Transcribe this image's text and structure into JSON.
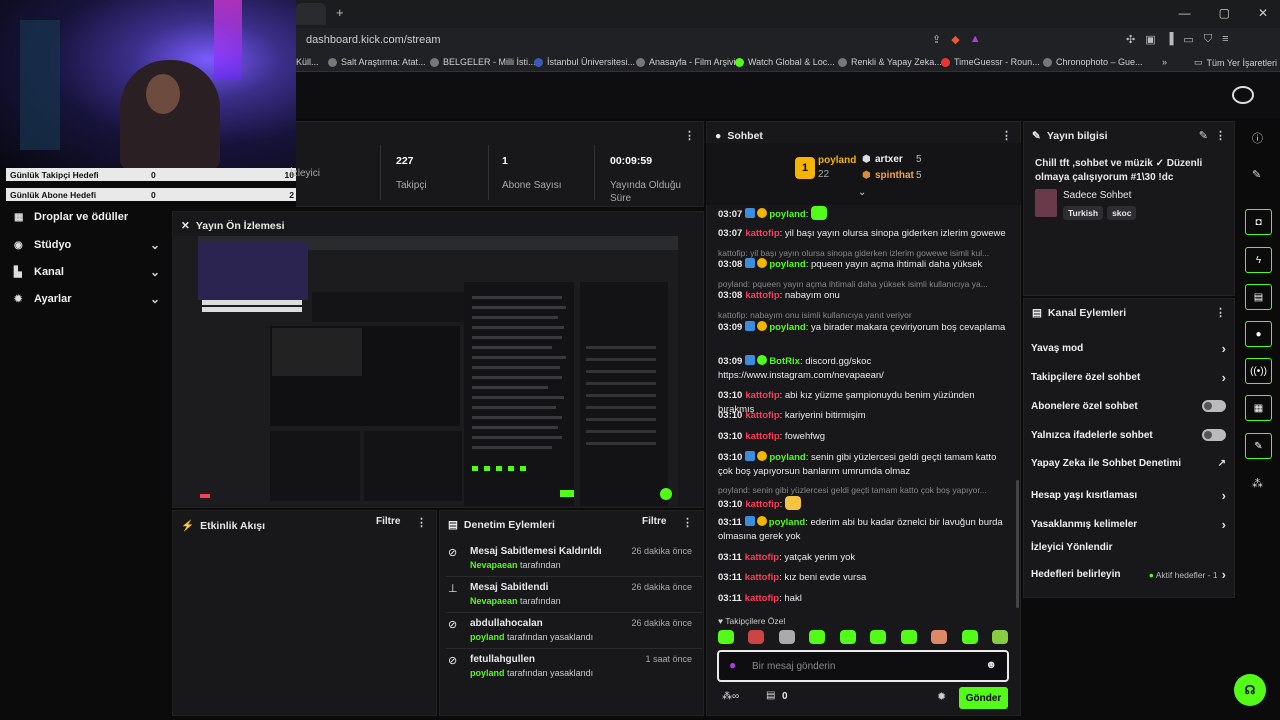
{
  "browser": {
    "url": "dashboard.kick.com/stream",
    "new_tab_symbol": "+",
    "window_controls": [
      "—",
      "▢",
      "✕"
    ],
    "bookmarks": [
      "Küll...",
      "Salt Araştırma: Atat...",
      "BELGELER - Milli İsti...",
      "İstanbul Üniversitesi...",
      "Anasayfa - Film Arşivi",
      "Watch Global & Loc...",
      "Renkli & Yapay Zeka...",
      "TimeGuessr - Roun...",
      "Chronophoto – Gue...",
      "»",
      "Tüm Yer İşaretleri"
    ]
  },
  "goals": [
    {
      "label": "Günlük Takipçi Hedefi",
      "current": "0",
      "target": "10"
    },
    {
      "label": "Günlük Abone Hedefi",
      "current": "0",
      "target": "2"
    }
  ],
  "nav": [
    {
      "label": "Droplar ve ödüller",
      "icon": "gift-icon"
    },
    {
      "label": "Stüdyo",
      "icon": "camera-icon"
    },
    {
      "label": "Kanal",
      "icon": "channel-icon"
    },
    {
      "label": "Ayarlar",
      "icon": "gear-icon"
    }
  ],
  "stats": [
    {
      "value": "",
      "label": "İzleyici"
    },
    {
      "value": "227",
      "label": "Takipçi"
    },
    {
      "value": "1",
      "label": "Abone Sayısı"
    },
    {
      "value": "00:09:59",
      "label": "Yayında Olduğu Süre"
    }
  ],
  "preview": {
    "title": "Yayın Ön İzlemesi"
  },
  "activity": {
    "title": "Etkinlik Akışı",
    "filter": "Filtre"
  },
  "moderation": {
    "title": "Denetim Eylemleri",
    "filter": "Filtre",
    "items": [
      {
        "title": "Mesaj Sabitlemesi Kaldırıldı",
        "actor": "Nevapaean",
        "suffix": "tarafından",
        "time": "26 dakika önce",
        "icon": "unpin-icon"
      },
      {
        "title": "Mesaj Sabitlendi",
        "actor": "Nevapaean",
        "suffix": "tarafından",
        "time": "26 dakika önce",
        "icon": "pin-icon"
      },
      {
        "title": "abdullahocalan",
        "actor": "poyland",
        "suffix": "tarafından yasaklandı",
        "time": "26 dakika önce",
        "icon": "ban-icon"
      },
      {
        "title": "fetullahgullen",
        "actor": "poyland",
        "suffix": "tarafından yasaklandı",
        "time": "1 saat önce",
        "icon": "ban-icon"
      }
    ]
  },
  "chat": {
    "title": "Sohbet",
    "leaders": [
      {
        "name": "poyland",
        "count": "22"
      },
      {
        "name": "artxer",
        "count": "5"
      },
      {
        "name": "spinthat",
        "count": "5"
      }
    ],
    "messages": [
      {
        "time": "03:07",
        "user": "poyland",
        "text": ":",
        "color": "green"
      },
      {
        "time": "03:07",
        "user": "kattofip",
        "text": ": yil başı yayın olursa sinopa giderken izlerim gowewe",
        "color": "red"
      },
      {
        "reply": "kattofip: yil başı yayın olursa sinopa giderken izlerim gowewe isimli kul..."
      },
      {
        "time": "03:08",
        "user": "poyland",
        "text": ": pqueen yayın açma ihtimali daha yüksek",
        "color": "green"
      },
      {
        "reply": "poyland: pqueen yayın açma ihtimali daha yüksek isimli kullanıcıya ya..."
      },
      {
        "time": "03:08",
        "user": "kattofip",
        "text": ": nabayım onu",
        "color": "red"
      },
      {
        "reply": "kattofip: nabayım onu isimli kullanıcıya yanıt veriyor"
      },
      {
        "time": "03:09",
        "user": "poyland",
        "text": ": ya birader makara çeviriyorum boş cevaplama",
        "color": "green"
      },
      {
        "time": "03:09",
        "user": "BotRix",
        "text": ": discord.gg/skoc https://www.instagram.com/nevapaean/",
        "color": "green"
      },
      {
        "time": "03:10",
        "user": "kattofip",
        "text": ": abi kız yüzme şampionuydu benim yüzünden bırakmış",
        "color": "red"
      },
      {
        "time": "03:10",
        "user": "kattofip",
        "text": ": kariyerini bitirmişim",
        "color": "red"
      },
      {
        "time": "03:10",
        "user": "kattofip",
        "text": ": fowehfwg",
        "color": "red"
      },
      {
        "time": "03:10",
        "user": "poyland",
        "text": ": senin gibi yüzlercesi geldi geçti tamam katto çok boş yapıyorsun banlarım umrumda olmaz",
        "color": "green"
      },
      {
        "reply": "poyland: senin gibi yüzlercesi geldi geçti tamam katto çok boş yapıyor..."
      },
      {
        "time": "03:10",
        "user": "kattofip",
        "text": ":",
        "color": "red"
      },
      {
        "time": "03:11",
        "user": "poyland",
        "text": ": ederim abi bu kadar öznelci bir lavuğun burda olmasına gerek yok",
        "color": "green"
      },
      {
        "time": "03:11",
        "user": "kattofip",
        "text": ": yatçak yerim yok",
        "color": "red"
      },
      {
        "time": "03:11",
        "user": "kattofip",
        "text": ": kız beni evde vursa",
        "color": "red"
      },
      {
        "time": "03:11",
        "user": "kattofip",
        "text": ": hakl",
        "color": "red"
      }
    ],
    "followers_only_label": "Takipçilere Özel",
    "input_placeholder": "Bir mesaj gönderin",
    "points": "0",
    "send_label": "Gönder"
  },
  "stream_info": {
    "title": "Yayın bilgisi",
    "stream_title": "Chill tft ,sohbet ve müzik ✓ Düzenli olmaya çalışıyorum #1\\30 !dc",
    "category": "Sadece Sohbet",
    "tags": [
      "Turkish",
      "skoc"
    ]
  },
  "channel_actions": {
    "title": "Kanal Eylemleri",
    "items": [
      {
        "label": "Yavaş mod",
        "control": "chevron"
      },
      {
        "label": "Takipçilere özel sohbet",
        "control": "chevron"
      },
      {
        "label": "Abonelere özel sohbet",
        "control": "toggle"
      },
      {
        "label": "Yalnızca ifadelerle sohbet",
        "control": "toggle"
      },
      {
        "label": "Yapay Zeka ile Sohbet Denetimi",
        "control": "external"
      },
      {
        "label": "Hesap yaşı kısıtlaması",
        "control": "chevron"
      },
      {
        "label": "Yasaklanmış kelimeler",
        "control": "chevron"
      },
      {
        "label": "İzleyici Yönlendir",
        "control": "none"
      },
      {
        "label": "Hedefleri belirleyin",
        "control": "chevron",
        "extra": "Aktif hedefler - 1"
      }
    ]
  },
  "colors": {
    "accent": "#53fc18",
    "danger": "#ff3c5a",
    "panel": "#18181b",
    "bg": "#0b0b0c"
  }
}
